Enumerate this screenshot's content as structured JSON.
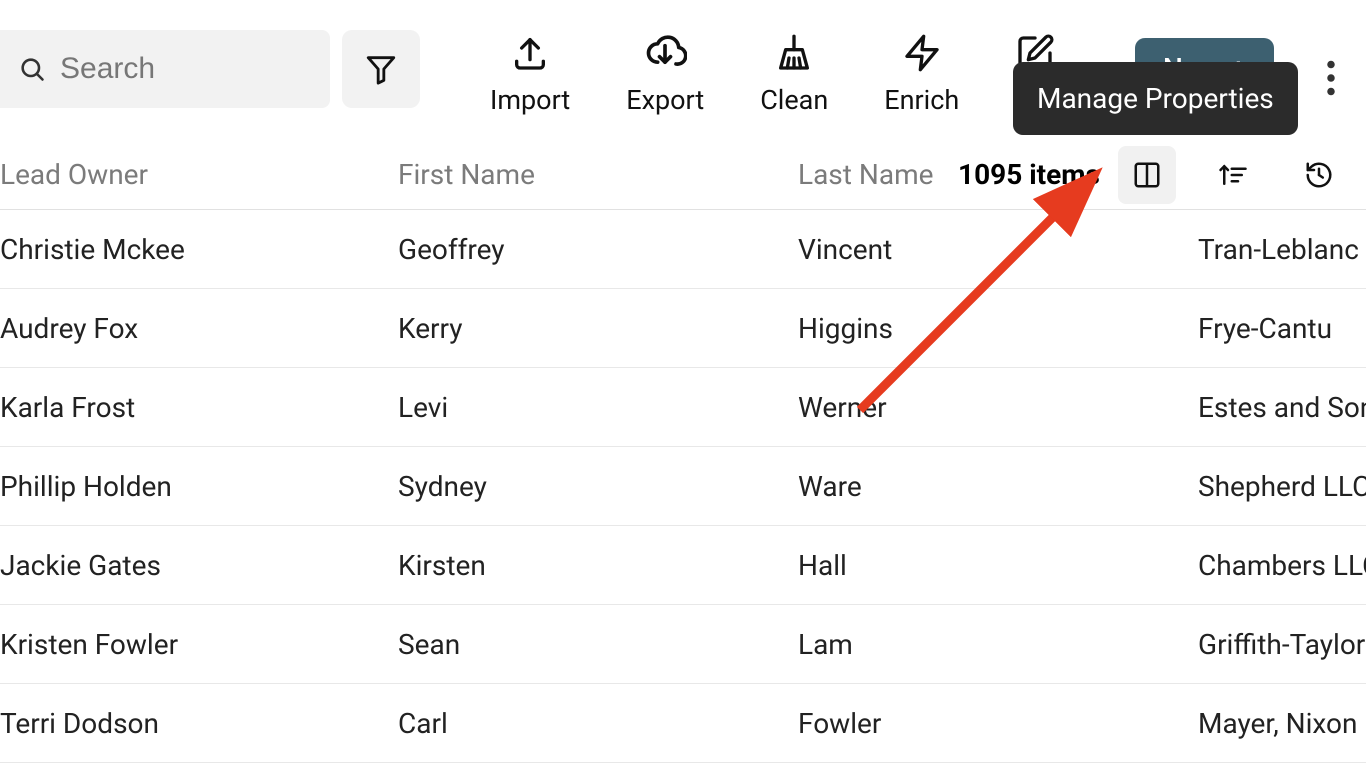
{
  "toolbar": {
    "search_placeholder": "Search",
    "actions": {
      "import": "Import",
      "export": "Export",
      "clean": "Clean",
      "enrich": "Enrich"
    },
    "new_label": "New",
    "tooltip": "Manage Properties"
  },
  "table": {
    "headers": {
      "lead_owner": "Lead Owner",
      "first_name": "First Name",
      "last_name": "Last Name"
    },
    "count_label": "1095 items",
    "rows": [
      {
        "owner": "Christie Mckee",
        "first": "Geoffrey",
        "last": "Vincent",
        "extra": "Tran-Leblanc"
      },
      {
        "owner": "Audrey Fox",
        "first": "Kerry",
        "last": "Higgins",
        "extra": "Frye-Cantu"
      },
      {
        "owner": "Karla Frost",
        "first": "Levi",
        "last": "Werner",
        "extra": "Estes and Sons"
      },
      {
        "owner": "Phillip Holden",
        "first": "Sydney",
        "last": "Ware",
        "extra": "Shepherd LLC"
      },
      {
        "owner": "Jackie Gates",
        "first": "Kirsten",
        "last": "Hall",
        "extra": "Chambers LLC"
      },
      {
        "owner": "Kristen Fowler",
        "first": "Sean",
        "last": "Lam",
        "extra": "Griffith-Taylor"
      },
      {
        "owner": "Terri Dodson",
        "first": "Carl",
        "last": "Fowler",
        "extra": "Mayer, Nixon"
      }
    ]
  }
}
